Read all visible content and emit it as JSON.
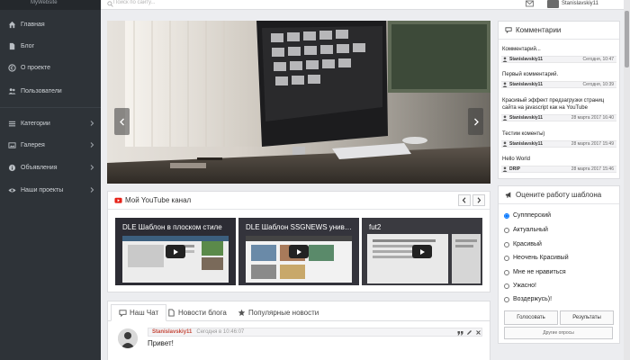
{
  "logo": "MyWebsite",
  "search": {
    "placeholder": "Поиск по сайту..."
  },
  "user": {
    "name": "Stanislavskiy11"
  },
  "sidebar": {
    "items": [
      {
        "label": "Главная",
        "icon": "home-icon"
      },
      {
        "label": "Блог",
        "icon": "file-icon"
      },
      {
        "label": "О проекте",
        "icon": "copyright-icon"
      },
      {
        "label": "Пользователи",
        "icon": "users-icon"
      },
      {
        "label": "Категории",
        "icon": "list-icon"
      },
      {
        "label": "Галерея",
        "icon": "image-icon"
      },
      {
        "label": "Объявления",
        "icon": "info-icon"
      },
      {
        "label": "Наши проекты",
        "icon": "eye-icon"
      }
    ]
  },
  "youtube": {
    "title": "Мой YouTube канал",
    "videos": [
      {
        "title": "DLE Шаблон в плоском стиле"
      },
      {
        "title": "DLE Шаблон SSGNEWS универсальный"
      },
      {
        "title": "fut2"
      }
    ]
  },
  "tabs": [
    {
      "label": "Наш Чат"
    },
    {
      "label": "Новости блога"
    },
    {
      "label": "Популярные новости"
    }
  ],
  "chat": {
    "author": "Stanislavskiy11",
    "time": "Сегодня в 10:46:07",
    "text": "Привет!"
  },
  "comments": {
    "title": "Комментарии",
    "items": [
      {
        "text": "Комментарий...",
        "author": "Stanislavskiy11",
        "date": "Сегодня, 10:47"
      },
      {
        "text": "Первый комментарий.",
        "author": "Stanislavskiy11",
        "date": "Сегодня, 10:39"
      },
      {
        "text": "Красивый эффект предзагрузки страниц сайта на javascript как на YouTube",
        "author": "Stanislavskiy11",
        "date": "28 марта 2017 16:40"
      },
      {
        "text": "Тестим коменты)",
        "author": "Stanislavskiy11",
        "date": "28 марта 2017 15:49"
      },
      {
        "text": "Hello World",
        "author": "DRIP",
        "date": "28 марта 2017 15:46"
      }
    ]
  },
  "poll": {
    "title": "Оцените работу шаблона",
    "options": [
      {
        "label": "Суппперский"
      },
      {
        "label": "Актуальный"
      },
      {
        "label": "Красивый"
      },
      {
        "label": "Неочень Красивый"
      },
      {
        "label": "Мне не нравиться"
      },
      {
        "label": "Ужасно!"
      },
      {
        "label": "Воздержусь)!"
      }
    ],
    "vote_label": "Голосовать",
    "results_label": "Результаты",
    "other_label": "Другие опросы"
  },
  "colors": {
    "sidebar_bg": "#2e3338",
    "youtube_red": "#e62117",
    "author_red": "#c5483a",
    "page_bg": "#ecedf0"
  }
}
